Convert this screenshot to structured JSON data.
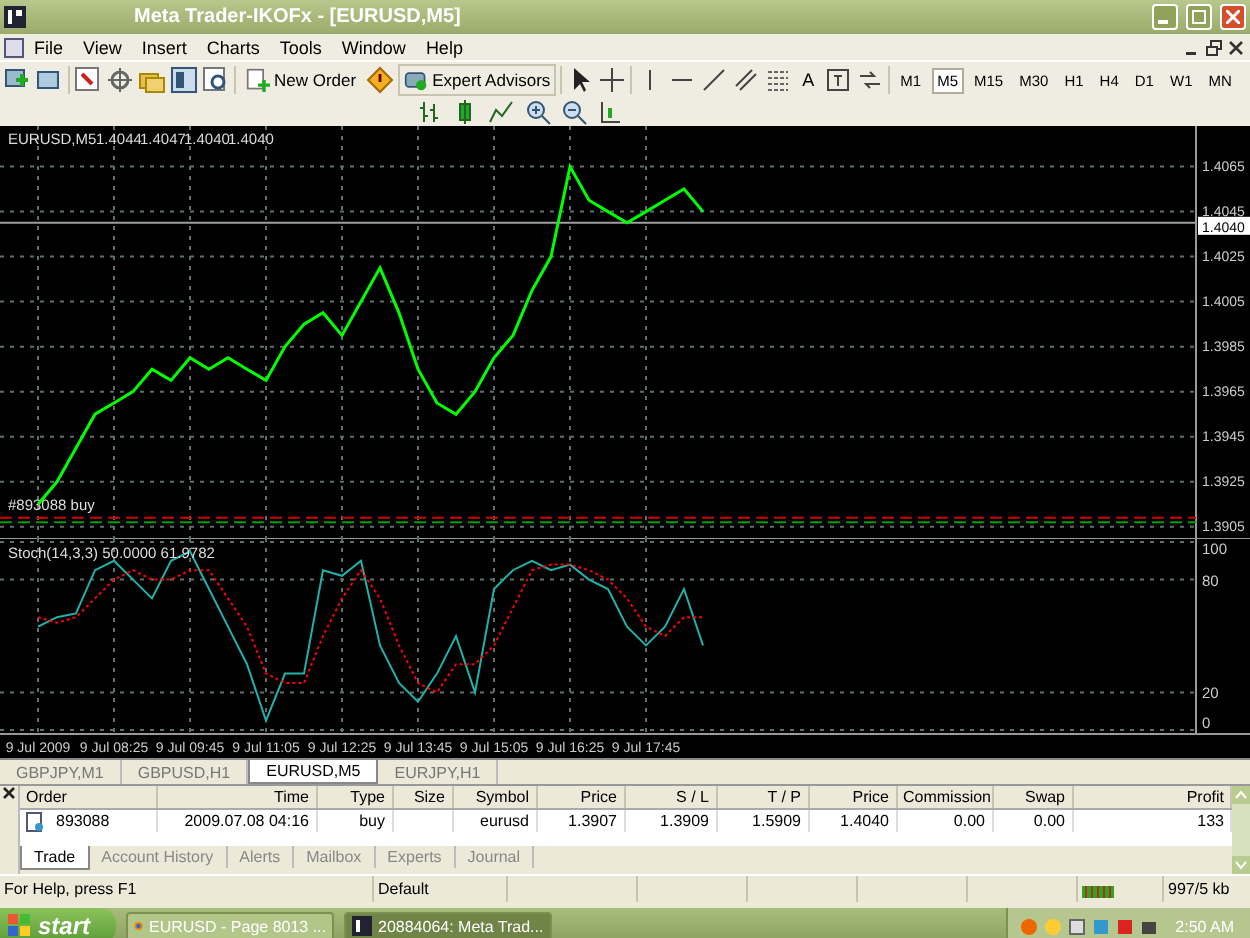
{
  "window": {
    "title": "Meta Trader-IKOFx - [EURUSD,M5]"
  },
  "menu": [
    "File",
    "View",
    "Insert",
    "Charts",
    "Tools",
    "Window",
    "Help"
  ],
  "toolbar": {
    "new_order": "New Order",
    "expert_advisors": "Expert Advisors",
    "text_tool": "A",
    "timeframes": [
      {
        "label": "M1",
        "selected": false
      },
      {
        "label": "M5",
        "selected": true
      },
      {
        "label": "M15",
        "selected": false
      },
      {
        "label": "M30",
        "selected": false
      },
      {
        "label": "H1",
        "selected": false
      },
      {
        "label": "H4",
        "selected": false
      },
      {
        "label": "D1",
        "selected": false
      },
      {
        "label": "W1",
        "selected": false
      },
      {
        "label": "MN",
        "selected": false
      }
    ]
  },
  "chart": {
    "header": {
      "symbol": "EURUSD,M5",
      "quotes": [
        "1.4044",
        "1.4047",
        "1.4040",
        "1.4040"
      ]
    },
    "chart_data": {
      "type": "line",
      "grid": true,
      "categories": [
        null,
        null,
        null,
        null,
        null,
        null,
        null,
        null,
        null,
        null,
        null,
        null,
        null,
        null,
        null,
        null,
        null,
        null,
        null,
        null,
        null,
        null,
        null,
        null,
        null,
        null,
        null,
        null,
        null,
        null,
        null,
        null,
        null,
        null,
        null,
        null,
        null,
        null,
        null,
        null,
        null,
        null,
        null,
        null,
        null,
        null,
        null,
        null,
        null,
        null,
        null,
        null,
        null,
        null,
        null,
        null,
        null,
        null,
        null,
        null,
        null
      ],
      "series": [
        {
          "color": "#00ff00",
          "values": [
            1.3915,
            1.3925,
            1.394,
            1.3955,
            1.396,
            1.3965,
            1.3975,
            1.397,
            1.398,
            1.3975,
            1.398,
            1.3975,
            1.397,
            1.3985,
            1.3995,
            1.4,
            1.399,
            1.4005,
            1.402,
            1.4,
            1.3975,
            1.396,
            1.3955,
            1.3965,
            1.398,
            1.399,
            1.401,
            1.4025,
            1.4065,
            1.405,
            1.4045,
            1.404,
            1.4045,
            1.405,
            1.4055,
            1.4045,
            null,
            null,
            null,
            null,
            null,
            null,
            null,
            null,
            null,
            null,
            null,
            null,
            null,
            null,
            null,
            null,
            null,
            null,
            null,
            null,
            null,
            null,
            null,
            null,
            null
          ]
        }
      ],
      "ylim": [
        1.39,
        1.4083
      ],
      "yticks": [
        1.3905,
        1.3925,
        1.3945,
        1.3965,
        1.3985,
        1.4005,
        1.4025,
        1.4045,
        1.4065
      ],
      "ref_lines": [
        {
          "axis": "y",
          "value": 1.3909,
          "color": "#d00000"
        },
        {
          "axis": "y",
          "value": 1.3907,
          "color": "#00a000",
          "label": "#893088 buy"
        },
        {
          "axis": "y",
          "value": 1.404,
          "color": "#a0a0a0"
        }
      ]
    },
    "current_price": "1.4040"
  },
  "indicator": {
    "label": "Stoch(14,3,3) 50.0000 61.9782",
    "chart_data": {
      "type": "line",
      "grid": true,
      "categories": [
        "9 Jul 2009",
        null,
        null,
        null,
        "9 Jul 08:25",
        null,
        null,
        null,
        "9 Jul 09:45",
        null,
        null,
        null,
        "9 Jul 11:05",
        null,
        null,
        null,
        "9 Jul 12:25",
        null,
        null,
        null,
        "9 Jul 13:45",
        null,
        null,
        null,
        "9 Jul 15:05",
        null,
        null,
        null,
        "9 Jul 16:25",
        null,
        null,
        null,
        "9 Jul 17:45",
        null,
        null,
        null,
        null,
        null,
        null,
        null,
        null,
        null,
        null,
        null,
        null,
        null,
        null,
        null,
        null,
        null,
        null,
        null,
        null,
        null,
        null,
        null,
        null,
        null,
        null,
        null,
        null
      ],
      "series": [
        {
          "color": "#20b2aa",
          "values": [
            55,
            60,
            62,
            85,
            90,
            80,
            70,
            90,
            95,
            75,
            55,
            35,
            5,
            30,
            30,
            85,
            82,
            90,
            45,
            25,
            15,
            30,
            50,
            20,
            75,
            85,
            90,
            85,
            88,
            80,
            75,
            55,
            45,
            55,
            75,
            45,
            null,
            null,
            null,
            null,
            null,
            null,
            null,
            null,
            null,
            null,
            null,
            null,
            null,
            null,
            null,
            null,
            null,
            null,
            null,
            null,
            null,
            null,
            null,
            null,
            null
          ]
        },
        {
          "color": "#ff0000",
          "line_style": "dotted",
          "values": [
            60,
            57,
            60,
            70,
            80,
            85,
            80,
            80,
            85,
            85,
            70,
            55,
            30,
            25,
            25,
            50,
            70,
            85,
            70,
            45,
            25,
            20,
            35,
            35,
            45,
            65,
            85,
            88,
            88,
            85,
            80,
            70,
            55,
            50,
            60,
            60,
            null,
            null,
            null,
            null,
            null,
            null,
            null,
            null,
            null,
            null,
            null,
            null,
            null,
            null,
            null,
            null,
            null,
            null,
            null,
            null,
            null,
            null,
            null,
            null,
            null
          ]
        }
      ],
      "ylim": [
        0,
        100
      ],
      "yticks": [
        0,
        20,
        80,
        100
      ]
    }
  },
  "chart_tabs": [
    {
      "label": "GBPJPY,M1",
      "selected": false
    },
    {
      "label": "GBPUSD,H1",
      "selected": false
    },
    {
      "label": "EURUSD,M5",
      "selected": true
    },
    {
      "label": "EURJPY,H1",
      "selected": false
    }
  ],
  "terminal": {
    "columns": [
      "Order",
      "Time",
      "Type",
      "Size",
      "Symbol",
      "Price",
      "S / L",
      "T / P",
      "Price",
      "Commission",
      "Swap",
      "Profit"
    ],
    "rows": [
      {
        "cells": [
          "893088",
          "2009.07.08 04:16",
          "buy",
          null,
          "eurusd",
          "1.3907",
          "1.3909",
          "1.5909",
          "1.4040",
          "0.00",
          "0.00",
          "133"
        ]
      }
    ],
    "tabs": [
      {
        "label": "Trade",
        "selected": true
      },
      {
        "label": "Account History",
        "selected": false
      },
      {
        "label": "Alerts",
        "selected": false
      },
      {
        "label": "Mailbox",
        "selected": false
      },
      {
        "label": "Experts",
        "selected": false
      },
      {
        "label": "Journal",
        "selected": false
      }
    ]
  },
  "status_bar": {
    "help": "For Help, press F1",
    "profile": "Default",
    "traffic": "997/5 kb"
  },
  "taskbar": {
    "start": "start",
    "tasks": [
      {
        "label": "EURUSD - Page 8013 ...",
        "selected": false
      },
      {
        "label": "20884064: Meta Trad...",
        "selected": true
      }
    ],
    "clock": "2:50 AM"
  }
}
